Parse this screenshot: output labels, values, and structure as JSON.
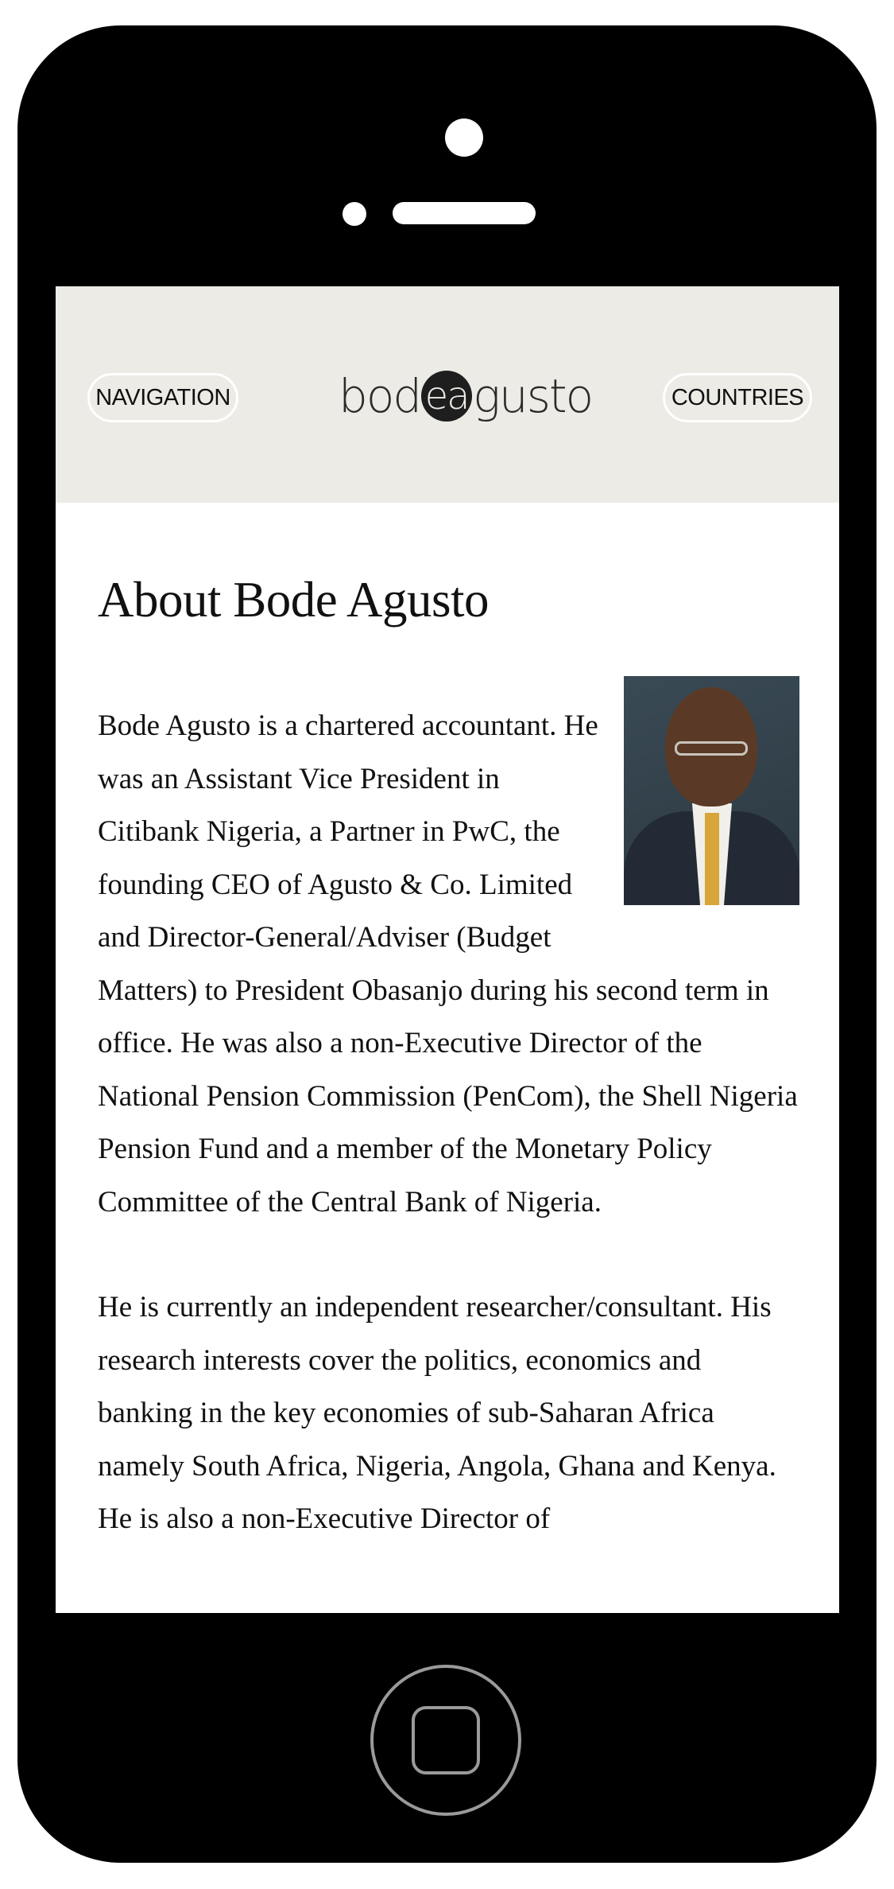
{
  "header": {
    "nav_label": "NAVIGATION",
    "logo_pre": "bod",
    "logo_mid": "ea",
    "logo_post": "gusto",
    "countries_label": "COUNTRIES",
    "background_color": "#ecebe6"
  },
  "article": {
    "title": "About Bode Agusto",
    "paragraphs": [
      "Bode Agusto is a chartered accountant. He was an Assistant Vice President in Citibank Nigeria, a Partner in PwC, the founding CEO of Agusto & Co. Limited and Director-General/Adviser (Budget Matters) to President Obasanjo during his second term in office. He was also a non-Executive Director of the National Pension Commission (PenCom), the Shell Nigeria Pension Fund and a member of the Monetary Policy Committee of the Central Bank of Nigeria.",
      "He is currently an independent researcher/consultant. His research interests cover the politics, economics and banking in the key economies of sub-Saharan Africa namely South Africa, Nigeria, Angola, Ghana and Kenya. He is also a non-Executive Director of"
    ],
    "portrait_alt": "portrait-photo"
  },
  "device": {
    "frame_color": "#000000",
    "home_button_color": "#9a9a9a"
  }
}
